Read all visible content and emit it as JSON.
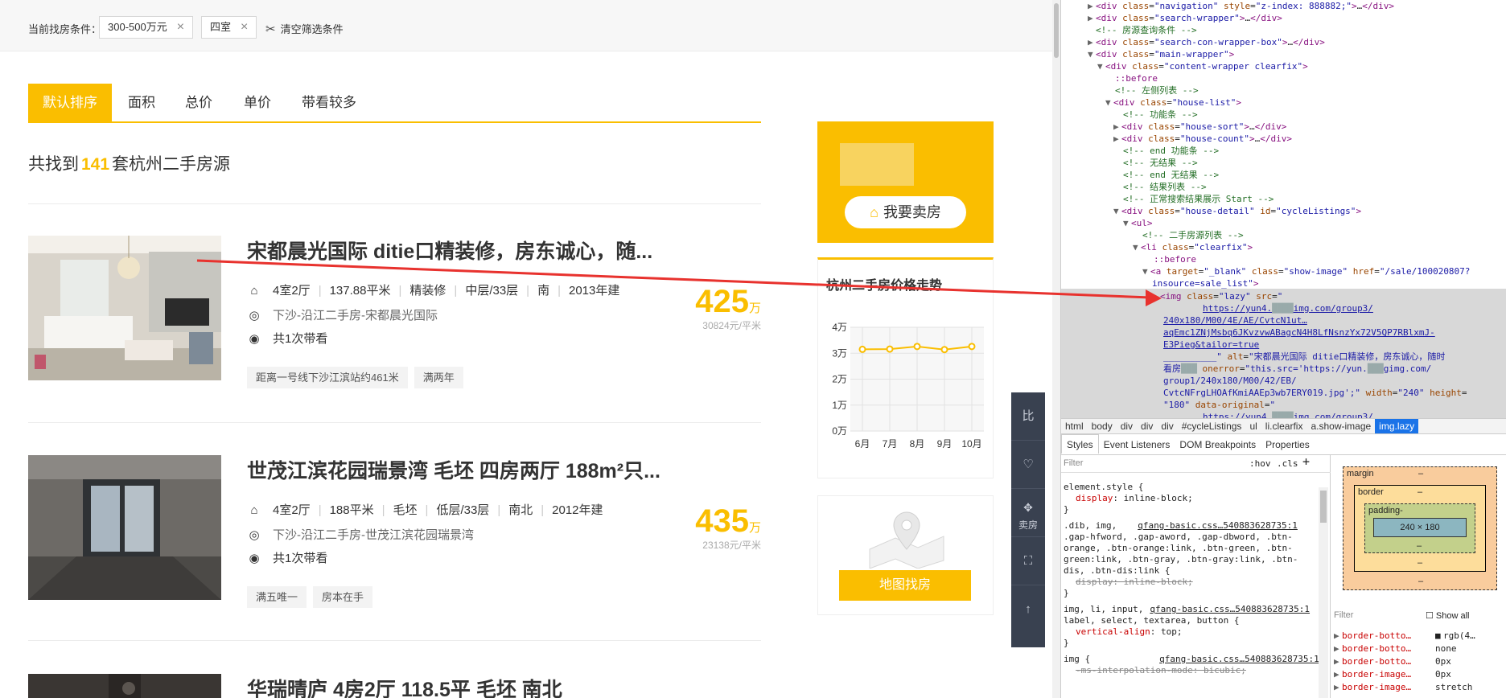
{
  "filters": {
    "label": "当前找房条件：",
    "chips": [
      {
        "text": "300-500万元"
      },
      {
        "text": "四室"
      }
    ],
    "clear_label": "清空筛选条件"
  },
  "sort": {
    "tabs": [
      {
        "label": "默认排序",
        "active": true
      },
      {
        "label": "面积"
      },
      {
        "label": "总价"
      },
      {
        "label": "单价"
      },
      {
        "label": "带看较多"
      }
    ]
  },
  "results": {
    "prefix": "共找到",
    "count": "141",
    "suffix": "套杭州二手房源"
  },
  "listings": [
    {
      "title": "宋都晨光国际 ditie口精装修，房东诚心，随...",
      "specs": [
        "4室2厅",
        "137.88平米",
        "精装修",
        "中层/33层",
        "南",
        "2013年建"
      ],
      "location": "下沙-沿江二手房-宋都晨光国际",
      "viewings": "共1次带看",
      "tags": [
        "距离一号线下沙江滨站约461米",
        "满两年"
      ],
      "price": "425",
      "price_unit": "万",
      "unit_price": "30824元/平米",
      "photo": "living-room"
    },
    {
      "title": "世茂江滨花园瑞景湾 毛坯 四房两厅 188m²只...",
      "specs": [
        "4室2厅",
        "188平米",
        "毛坯",
        "低层/33层",
        "南北",
        "2012年建"
      ],
      "location": "下沙-沿江二手房-世茂江滨花园瑞景湾",
      "viewings": "共1次带看",
      "tags": [
        "满五唯一",
        "房本在手"
      ],
      "price": "435",
      "price_unit": "万",
      "unit_price": "23138元/平米",
      "photo": "empty-room"
    },
    {
      "title": "华瑞晴庐 4房2厅 118.5平 毛坯 南北",
      "photo": "dark-room"
    }
  ],
  "sidebar": {
    "sell_button": "我要卖房",
    "trend_title": "杭州二手房价格走势",
    "map_button": "地图找房"
  },
  "chart_data": {
    "type": "line",
    "title": "杭州二手房价格走势",
    "categories": [
      "6月",
      "7月",
      "8月",
      "9月",
      "10月"
    ],
    "values": [
      31500,
      31600,
      32600,
      31400,
      32600
    ],
    "y_ticks": [
      "0万",
      "1万",
      "2万",
      "3万",
      "4万"
    ],
    "ylim": [
      0,
      40000
    ],
    "grid": true,
    "color": "#fabe00"
  },
  "side_tools": {
    "compare": "比",
    "sell": "卖房"
  },
  "colors": {
    "accent": "#fabe00",
    "tool_bg": "#394150",
    "selection": "#1a73e8"
  },
  "devtools": {
    "breadcrumbs": [
      "html",
      "body",
      "div",
      "div",
      "div",
      "#cycleListings",
      "ul",
      "li.clearfix",
      "a.show-image",
      "img.lazy"
    ],
    "tabs": [
      "Styles",
      "Event Listeners",
      "DOM Breakpoints",
      "Properties"
    ],
    "styles_filter": "Filter",
    "hov": ":hov",
    "cls": ".cls",
    "box_model": {
      "margin": "margin",
      "border": "border",
      "padding": "padding-",
      "content": "240 × 180",
      "dash": "–"
    },
    "computed_filter": "Filter",
    "show_all": "Show all",
    "computed": [
      {
        "prop": "border-botto…",
        "val": "rgb(4…"
      },
      {
        "prop": "border-botto…",
        "val": "none"
      },
      {
        "prop": "border-botto…",
        "val": "0px"
      },
      {
        "prop": "border-image…",
        "val": "0px"
      },
      {
        "prop": "border-image…",
        "val": "stretch"
      }
    ]
  }
}
